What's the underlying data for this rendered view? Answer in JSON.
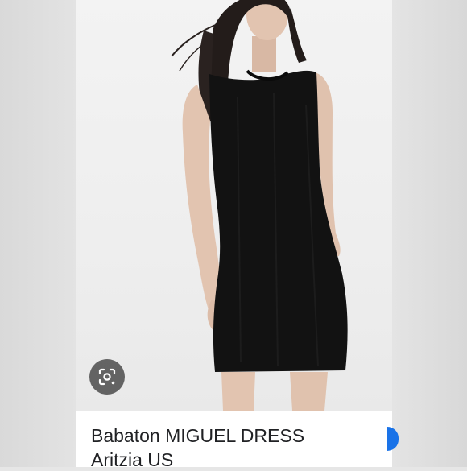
{
  "product": {
    "title_line1": "Babaton MIGUEL DRESS",
    "title_line2": "Aritzia US"
  },
  "icons": {
    "lens": "visual-search-icon"
  },
  "colors": {
    "background": "#e6e6e6",
    "photo_background": "#f0f0f0",
    "dress": "#121212",
    "caption_background": "#ffffff",
    "caption_text": "#202124",
    "accent": "#1a73e8"
  }
}
